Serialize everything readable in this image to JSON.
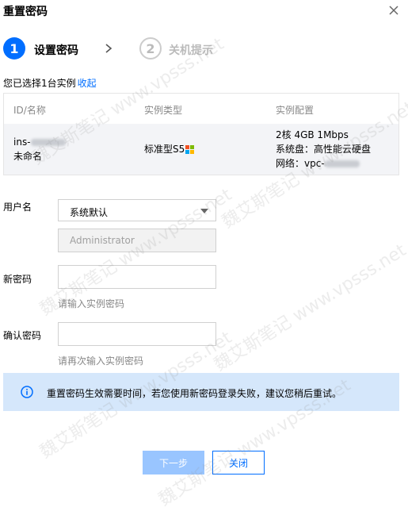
{
  "dialog": {
    "title": "重置密码"
  },
  "steps": [
    {
      "number": "1",
      "label": "设置密码"
    },
    {
      "number": "2",
      "label": "关机提示"
    }
  ],
  "selection": {
    "text": "您已选择1台实例",
    "collapse_label": "收起"
  },
  "table": {
    "headers": [
      "ID/名称",
      "实例类型",
      "实例配置"
    ],
    "row": {
      "id_prefix": "ins-",
      "name": "未命名",
      "instance_type": "标准型S5",
      "config_cpu_mem_bw": "2核 4GB 1Mbps",
      "config_disk": "系统盘：高性能云硬盘",
      "config_network_prefix": "网络：vpc-"
    }
  },
  "form": {
    "username_label": "用户名",
    "username_select_value": "系统默认",
    "username_value": "Administrator",
    "new_password_label": "新密码",
    "new_password_hint": "请输入实例密码",
    "confirm_password_label": "确认密码",
    "confirm_password_hint": "请再次输入实例密码"
  },
  "notice": {
    "text": "重置密码生效需要时间，若您使用新密码登录失败，建议您稍后重试。"
  },
  "buttons": {
    "next": "下一步",
    "close": "关闭"
  },
  "colors": {
    "primary": "#006eff",
    "primary_disabled": "#99c5ff",
    "notice_bg": "#d5e7fb",
    "muted": "#888888"
  },
  "watermark": {
    "text": "魏艾斯笔记 www.vpsss.net"
  }
}
